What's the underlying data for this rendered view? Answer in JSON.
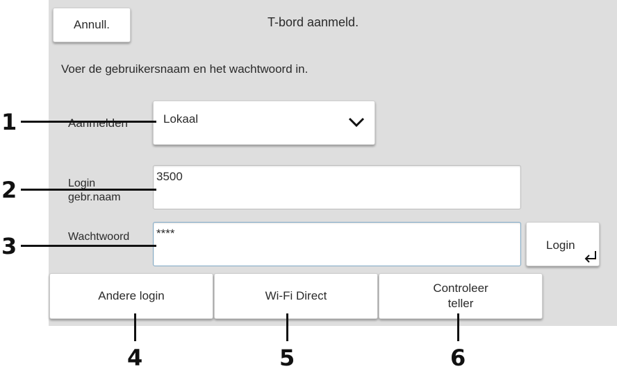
{
  "header": {
    "cancel_label": "Annull.",
    "title": "T-bord aanmeld."
  },
  "instruction": "Voer de gebruikersnaam en het wachtwoord in.",
  "login_type": {
    "label": "Aanmelden",
    "value": "Lokaal",
    "icon": "chevron-down-icon"
  },
  "username": {
    "label_line1": "Login",
    "label_line2": "gebr.naam",
    "value": "3500"
  },
  "password": {
    "label": "Wachtwoord",
    "value": "****"
  },
  "login_button": {
    "label": "Login",
    "icon": "enter-icon"
  },
  "footer_buttons": {
    "other_login": "Andere login",
    "wifi_direct": "Wi-Fi Direct",
    "check_counter_line1": "Controleer",
    "check_counter_line2": "teller"
  },
  "callouts": [
    "1",
    "2",
    "3",
    "4",
    "5",
    "6"
  ]
}
